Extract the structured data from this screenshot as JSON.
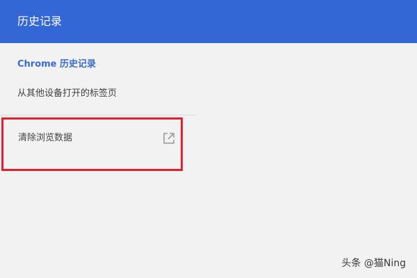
{
  "colors": {
    "accent": "#3367d6",
    "link": "#3b6bd1",
    "highlight": "#e3202c"
  },
  "header": {
    "title": "历史记录"
  },
  "sidebar": {
    "items": [
      {
        "label": "Chrome 历史记录"
      },
      {
        "label": "从其他设备打开的标签页"
      }
    ],
    "clear_data": {
      "label": "清除浏览数据",
      "icon": "open-in-new-icon"
    }
  },
  "watermark": {
    "text": "头条 @猫Ning"
  }
}
